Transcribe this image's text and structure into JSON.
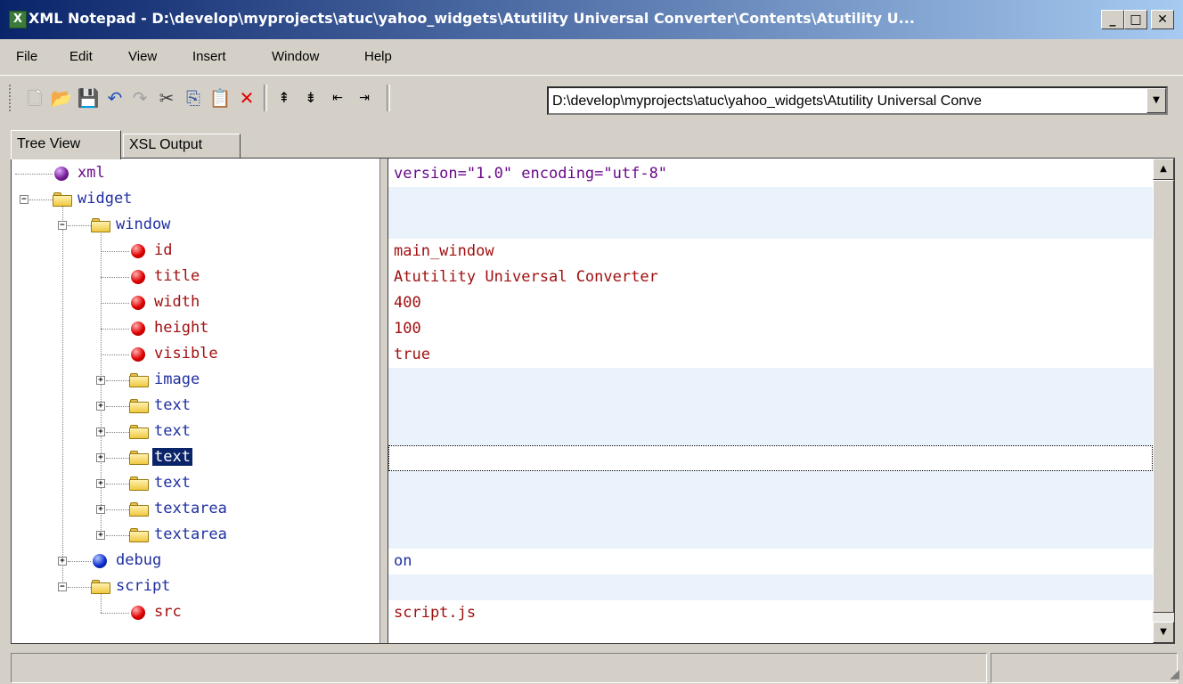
{
  "window": {
    "title": "XML Notepad - D:\\develop\\myprojects\\atuc\\yahoo_widgets\\Atutility Universal Converter\\Contents\\Atutility U...",
    "icon": "xml-notepad-icon"
  },
  "title_buttons": {
    "minimize": "_",
    "maximize": "□",
    "close": "✕"
  },
  "menu": [
    "File",
    "Edit",
    "View",
    "Insert",
    "Window",
    "Help"
  ],
  "toolbar": {
    "path": "D:\\develop\\myprojects\\atuc\\yahoo_widgets\\Atutility Universal Conve",
    "icons": [
      "new-icon",
      "open-icon",
      "save-icon",
      "undo-icon",
      "redo-icon",
      "cut-icon",
      "copy-icon",
      "paste-icon",
      "delete-icon",
      "nudge-up-icon",
      "nudge-down-icon",
      "nudge-left-icon",
      "nudge-right-icon"
    ]
  },
  "tabs": [
    "Tree View",
    "XSL Output"
  ],
  "tree": [
    {
      "label": "xml",
      "value": "version=\"1.0\" encoding=\"utf-8\"",
      "icon": "pi-ball-icon",
      "depth": 0,
      "expander": "",
      "kind": "pi"
    },
    {
      "label": "widget",
      "value": "",
      "icon": "folder-icon",
      "depth": 0,
      "expander": "-",
      "kind": "elem"
    },
    {
      "label": "window",
      "value": "",
      "icon": "folder-icon",
      "depth": 1,
      "expander": "-",
      "kind": "elem"
    },
    {
      "label": "id",
      "value": "main_window",
      "icon": "attribute-ball-icon",
      "depth": 2,
      "expander": "",
      "kind": "attr"
    },
    {
      "label": "title",
      "value": "Atutility Universal Converter",
      "icon": "attribute-ball-icon",
      "depth": 2,
      "expander": "",
      "kind": "attr"
    },
    {
      "label": "width",
      "value": "400",
      "icon": "attribute-ball-icon",
      "depth": 2,
      "expander": "",
      "kind": "attr"
    },
    {
      "label": "height",
      "value": "100",
      "icon": "attribute-ball-icon",
      "depth": 2,
      "expander": "",
      "kind": "attr"
    },
    {
      "label": "visible",
      "value": "true",
      "icon": "attribute-ball-icon",
      "depth": 2,
      "expander": "",
      "kind": "attr"
    },
    {
      "label": "image",
      "value": "",
      "icon": "folder-icon",
      "depth": 2,
      "expander": "+",
      "kind": "elem"
    },
    {
      "label": "text",
      "value": "",
      "icon": "folder-icon",
      "depth": 2,
      "expander": "+",
      "kind": "elem"
    },
    {
      "label": "text",
      "value": "",
      "icon": "folder-icon",
      "depth": 2,
      "expander": "+",
      "kind": "elem"
    },
    {
      "label": "text",
      "value": "",
      "icon": "folder-icon",
      "depth": 2,
      "expander": "+",
      "kind": "elem",
      "selected": true
    },
    {
      "label": "text",
      "value": "",
      "icon": "folder-icon",
      "depth": 2,
      "expander": "+",
      "kind": "elem"
    },
    {
      "label": "textarea",
      "value": "",
      "icon": "folder-icon",
      "depth": 2,
      "expander": "+",
      "kind": "elem"
    },
    {
      "label": "textarea",
      "value": "",
      "icon": "folder-icon",
      "depth": 2,
      "expander": "+",
      "kind": "elem"
    },
    {
      "label": "debug",
      "value": "on",
      "icon": "element-ball-icon",
      "depth": 1,
      "expander": "+",
      "kind": "leafelem"
    },
    {
      "label": "script",
      "value": "",
      "icon": "folder-icon",
      "depth": 1,
      "expander": "-",
      "kind": "elem"
    },
    {
      "label": "src",
      "value": "script.js",
      "icon": "attribute-ball-icon",
      "depth": 2,
      "expander": "",
      "kind": "attr"
    }
  ],
  "colors": {
    "title_start": "#0a246a",
    "title_end": "#a6caf0",
    "label_elem": "#1f2fa0",
    "label_attr": "#a01010",
    "label_pi": "#6a0a8a",
    "selection": "#0a246a",
    "shade": "#eaf2fb"
  },
  "status": [
    "",
    ""
  ]
}
